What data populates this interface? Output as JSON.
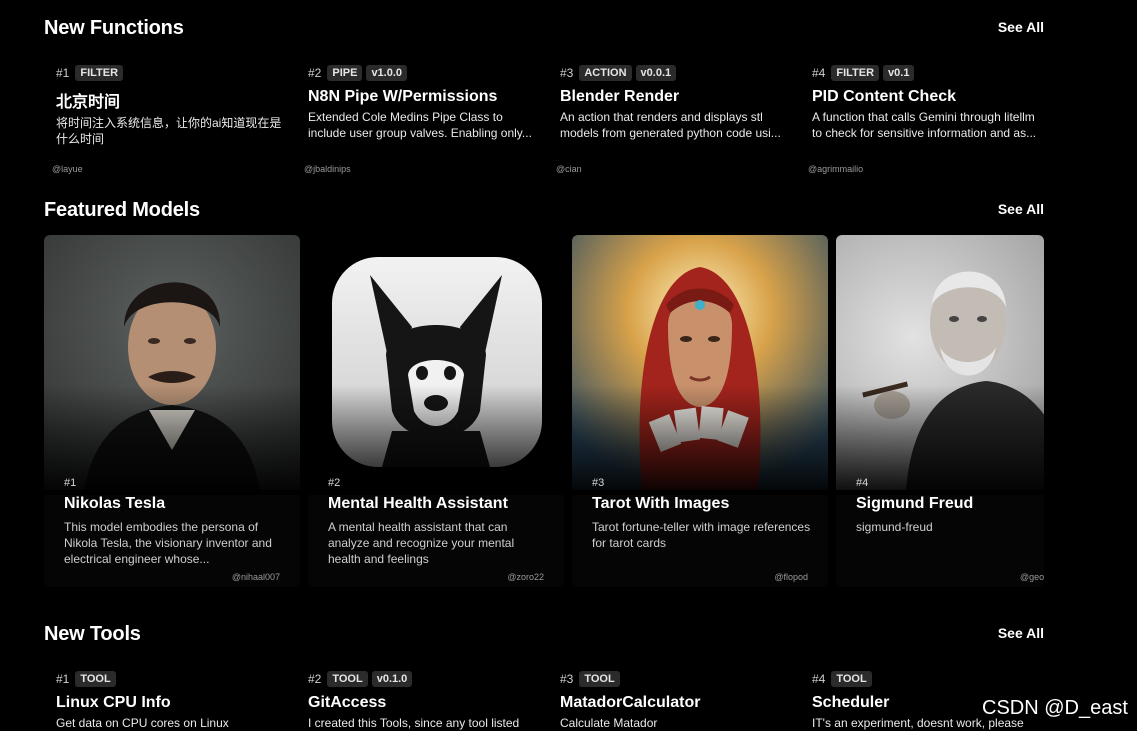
{
  "functions_section": {
    "title": "New Functions",
    "see_all": "See All",
    "items": [
      {
        "rank": "#1",
        "tags": [
          "FILTER"
        ],
        "name": "北京时间",
        "desc": "将时间注入系统信息，让你的ai知道现在是什么时间",
        "author": "@layue"
      },
      {
        "rank": "#2",
        "tags": [
          "PIPE",
          "v1.0.0"
        ],
        "name": "N8N Pipe W/Permissions",
        "desc": "Extended Cole Medins Pipe Class to include user group valves. Enabling only...",
        "author": "@jbaldinips"
      },
      {
        "rank": "#3",
        "tags": [
          "ACTION",
          "v0.0.1"
        ],
        "name": "Blender Render",
        "desc": "An action that renders and displays stl models from generated python code usi...",
        "author": "@cian"
      },
      {
        "rank": "#4",
        "tags": [
          "FILTER",
          "v0.1"
        ],
        "name": "PID Content Check",
        "desc": "A function that calls Gemini through litellm to check for sensitive information and as...",
        "author": "@agrimmailio"
      }
    ]
  },
  "models_section": {
    "title": "Featured Models",
    "see_all": "See All",
    "items": [
      {
        "rank": "#1",
        "name": "Nikolas Tesla",
        "desc": "This model embodies the persona of Nikola Tesla, the visionary inventor and electrical engineer whose...",
        "author": "@nihaal007",
        "image": "portrait-tesla"
      },
      {
        "rank": "#2",
        "name": "Mental Health Assistant",
        "desc": "A mental health assistant that can analyze and recognize your mental health and feelings",
        "author": "@zoro22",
        "image": "llama-logo"
      },
      {
        "rank": "#3",
        "name": "Tarot With Images",
        "desc": "Tarot fortune-teller with image references for tarot cards",
        "author": "@flopod",
        "image": "tarot-reader"
      },
      {
        "rank": "#4",
        "name": "Sigmund Freud",
        "desc": "sigmund-freud",
        "author": "@geo",
        "image": "portrait-freud"
      }
    ]
  },
  "tools_section": {
    "title": "New Tools",
    "see_all": "See All",
    "items": [
      {
        "rank": "#1",
        "tags": [
          "TOOL"
        ],
        "name": "Linux CPU Info",
        "desc": "Get data on CPU cores on Linux"
      },
      {
        "rank": "#2",
        "tags": [
          "TOOL",
          "v0.1.0"
        ],
        "name": "GitAccess",
        "desc": "I created this Tools, since any tool listed"
      },
      {
        "rank": "#3",
        "tags": [
          "TOOL"
        ],
        "name": "MatadorCalculator",
        "desc": "Calculate Matador"
      },
      {
        "rank": "#4",
        "tags": [
          "TOOL"
        ],
        "name": "Scheduler",
        "desc": "IT's an experiment, doesnt work, please"
      }
    ]
  },
  "watermark": "CSDN @D_east"
}
